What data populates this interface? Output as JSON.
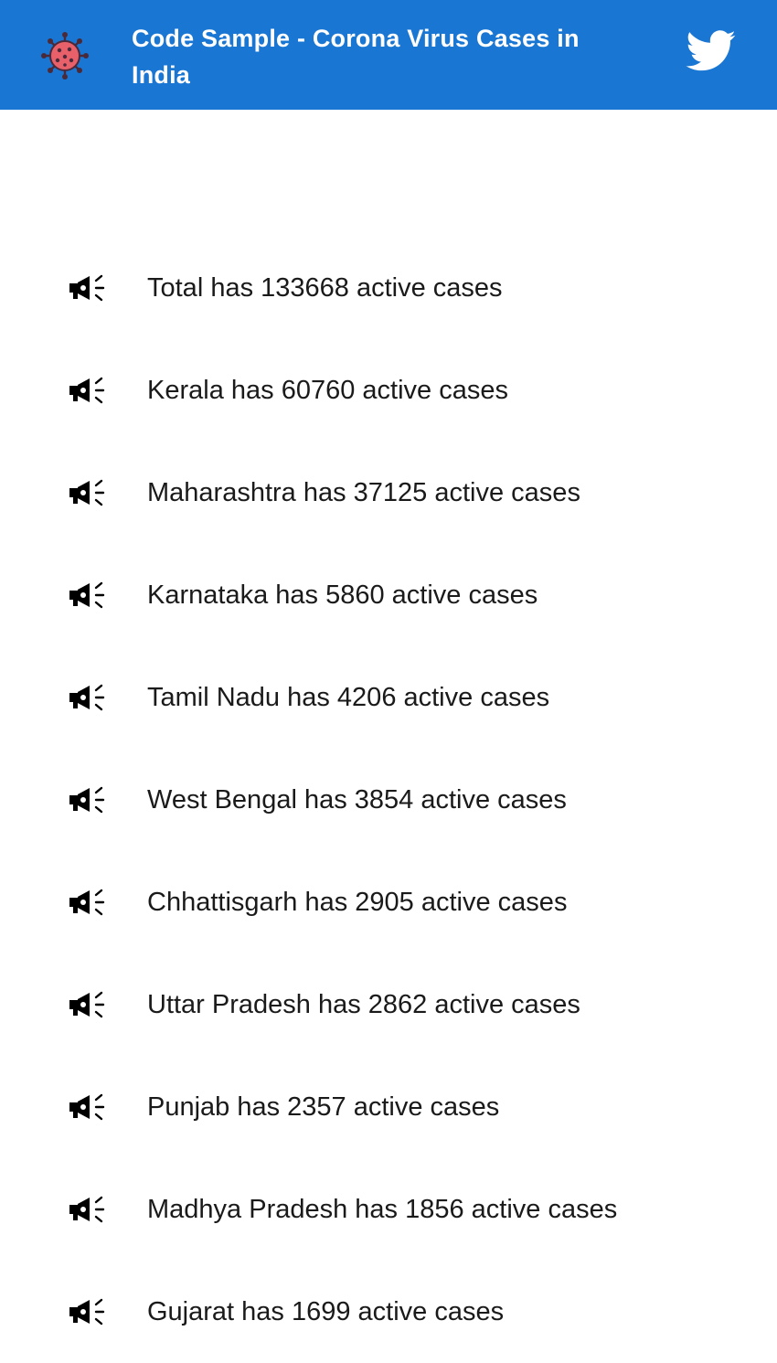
{
  "header": {
    "title": "Code Sample - Corona Virus Cases in India",
    "background": "#1976d2",
    "logo_icon": "coronavirus-icon",
    "action_icon": "twitter-icon"
  },
  "cases": [
    {
      "text": "Total has 133668 active cases",
      "icon": "megaphone-icon"
    },
    {
      "text": "Kerala has 60760 active cases",
      "icon": "megaphone-icon"
    },
    {
      "text": "Maharashtra has 37125 active cases",
      "icon": "megaphone-icon"
    },
    {
      "text": "Karnataka has 5860 active cases",
      "icon": "megaphone-icon"
    },
    {
      "text": "Tamil Nadu has 4206 active cases",
      "icon": "megaphone-icon"
    },
    {
      "text": "West Bengal has 3854 active cases",
      "icon": "megaphone-icon"
    },
    {
      "text": "Chhattisgarh has 2905 active cases",
      "icon": "megaphone-icon"
    },
    {
      "text": "Uttar Pradesh has 2862 active cases",
      "icon": "megaphone-icon"
    },
    {
      "text": "Punjab has 2357 active cases",
      "icon": "megaphone-icon"
    },
    {
      "text": "Madhya Pradesh has 1856 active cases",
      "icon": "megaphone-icon"
    },
    {
      "text": "Gujarat has 1699 active cases",
      "icon": "megaphone-icon"
    }
  ]
}
